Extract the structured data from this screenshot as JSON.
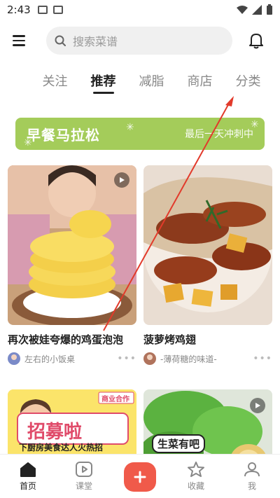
{
  "status_bar": {
    "time": "2:43"
  },
  "search": {
    "placeholder": "搜索菜谱"
  },
  "tabs": [
    {
      "label": "关注"
    },
    {
      "label": "推荐"
    },
    {
      "label": "减脂"
    },
    {
      "label": "商店"
    },
    {
      "label": "分类"
    }
  ],
  "banner": {
    "title": "早餐马拉松",
    "subtitle": "最后一天冲刺中"
  },
  "feed": [
    {
      "title": "再次被娃夸爆的鸡蛋泡泡",
      "author": "左右的小饭桌"
    },
    {
      "title": "菠萝烤鸡翅",
      "author": "-薄荷糖的味道-"
    }
  ],
  "promo_card": {
    "tag": "商业合作",
    "headline": "招募啦",
    "subline": "下厨房美食达人火热招"
  },
  "lettuce_card": {
    "label": "生菜有吧"
  },
  "bottom_nav": [
    {
      "label": "首页"
    },
    {
      "label": "课堂"
    },
    {
      "label": ""
    },
    {
      "label": "收藏"
    },
    {
      "label": "我"
    }
  ],
  "colors": {
    "accent": "#f05a4a",
    "banner": "#a4cc5a"
  }
}
